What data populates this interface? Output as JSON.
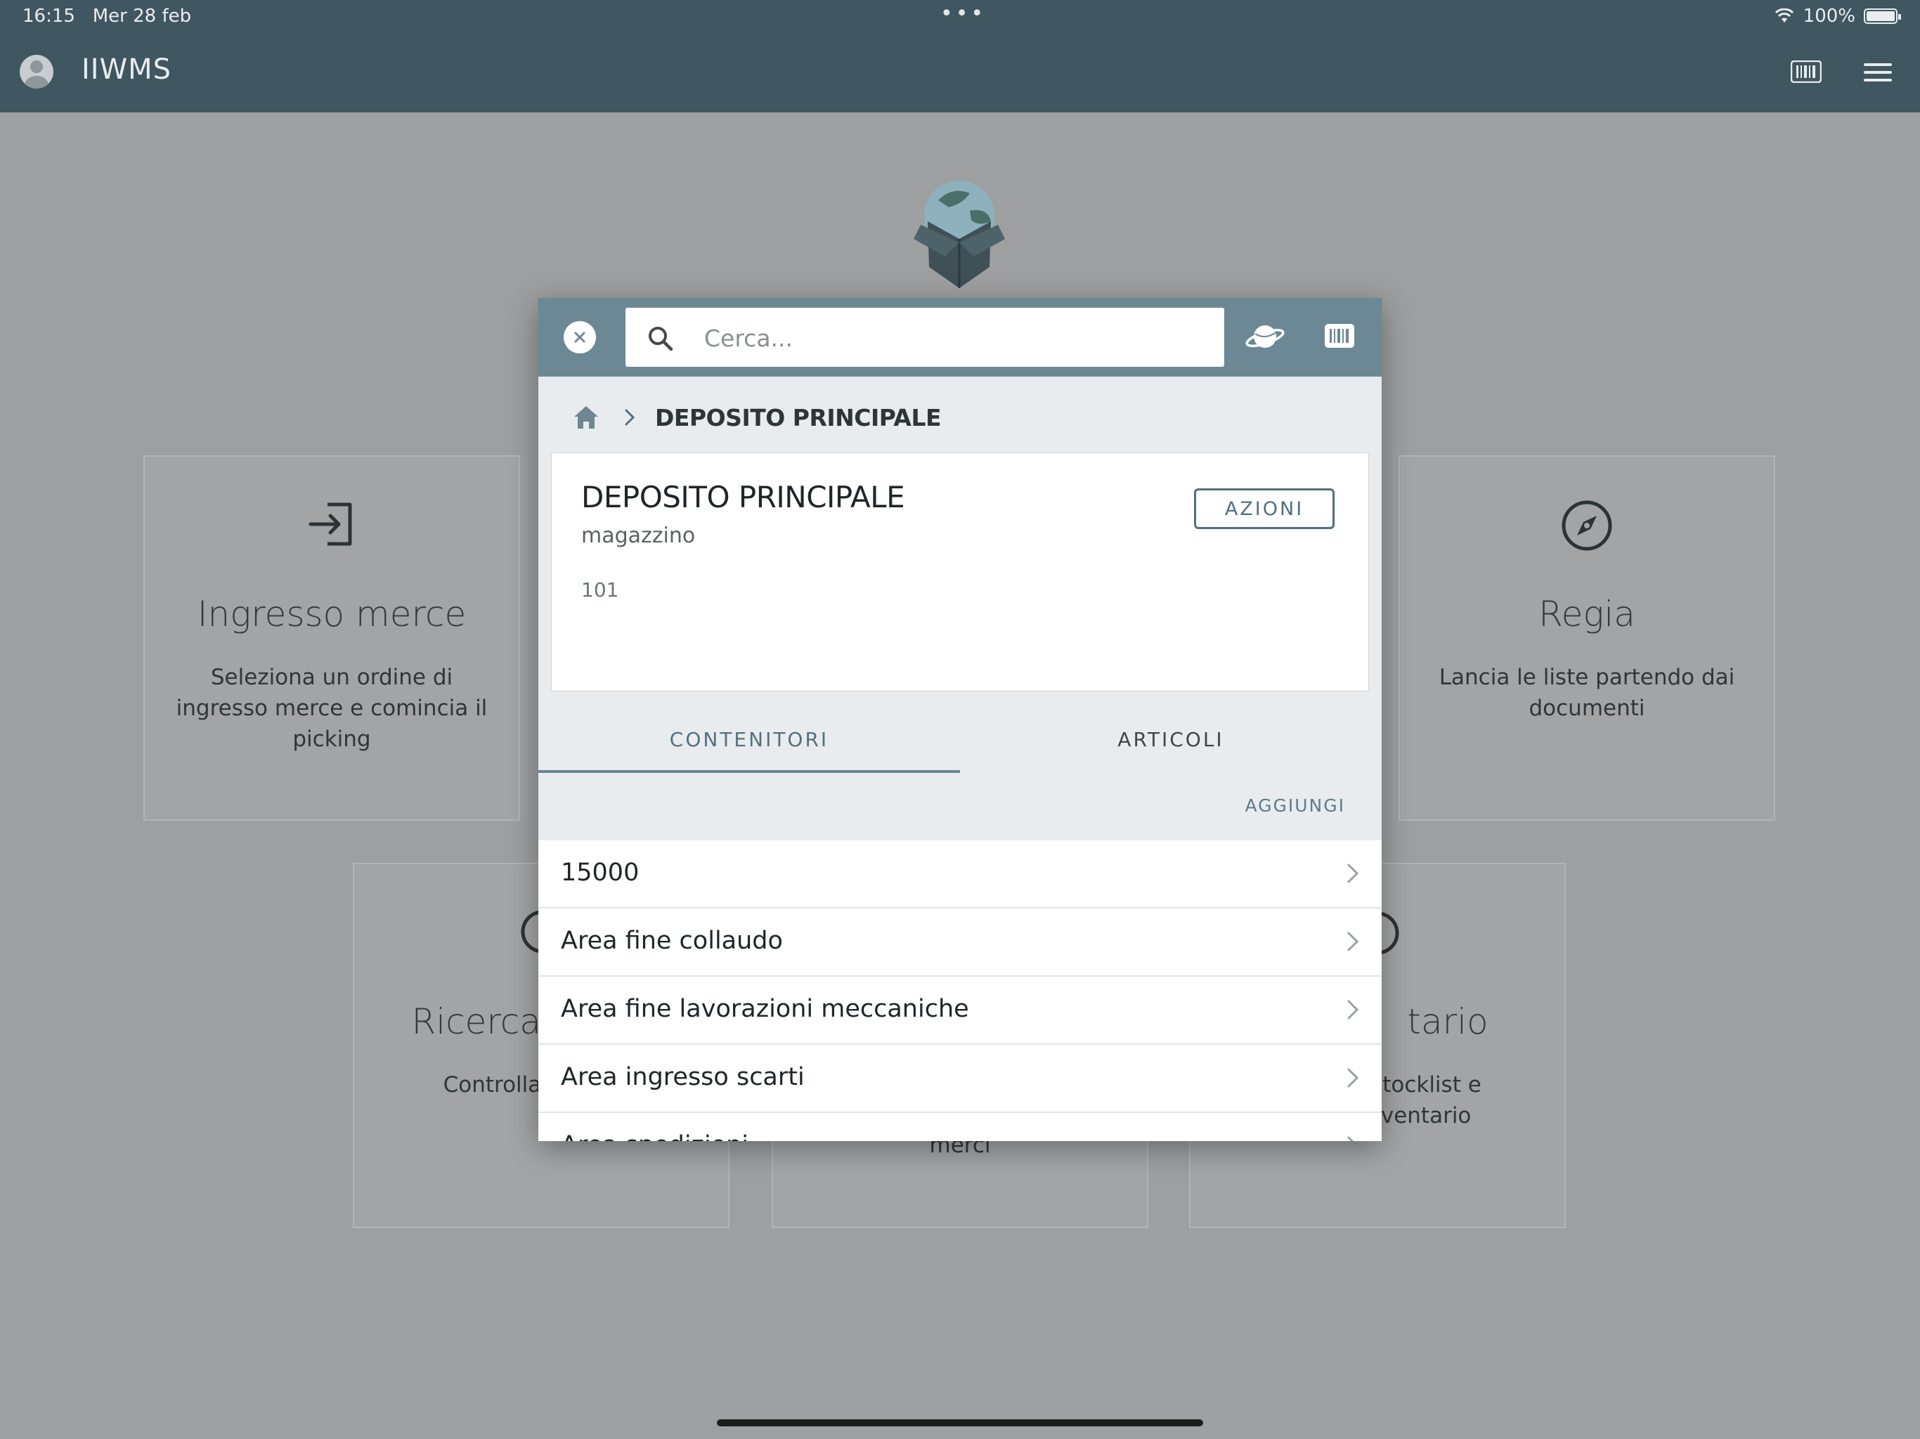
{
  "status_bar": {
    "time": "16:15",
    "date": "Mer 28 feb",
    "battery": "100%"
  },
  "header": {
    "title": "IIWMS"
  },
  "dashboard": {
    "cards": [
      {
        "title": "Ingresso merce",
        "description": "Seleziona un ordine di ingresso merce e comincia il picking",
        "icon": "login-arrow-icon"
      },
      {
        "title": "Regia",
        "description": "Lancia le liste partendo dai documenti",
        "icon": "compass-icon"
      },
      {
        "title": "Ricerca m",
        "description": "Controlla gli ul ins",
        "icon": "search-icon"
      },
      {
        "title": "",
        "description": "merci",
        "icon": ""
      },
      {
        "title": "tario",
        "description": "a stocklist e inventario",
        "icon": "planet-icon"
      }
    ]
  },
  "modal": {
    "search": {
      "placeholder": "Cerca..."
    },
    "breadcrumb": {
      "current": "DEPOSITO PRINCIPALE"
    },
    "info": {
      "title": "DEPOSITO PRINCIPALE",
      "subtitle": "magazzino",
      "code": "101",
      "actions_label": "AZIONI"
    },
    "tabs": [
      {
        "label": "CONTENITORI",
        "active": true
      },
      {
        "label": "ARTICOLI",
        "active": false
      }
    ],
    "add_label": "AGGIUNGI",
    "items": [
      {
        "label": "15000"
      },
      {
        "label": "Area fine collaudo"
      },
      {
        "label": "Area fine lavorazioni meccaniche"
      },
      {
        "label": "Area ingresso scarti"
      },
      {
        "label": "Area spedizioni"
      }
    ]
  }
}
